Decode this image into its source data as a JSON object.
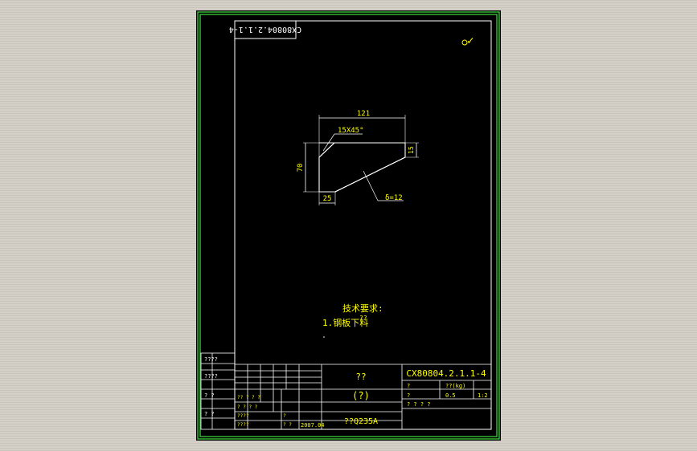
{
  "drawing": {
    "rotated_number": "CX80804.2.1.1-4",
    "surface_mark": "✓",
    "dims": {
      "width_top": "121",
      "chamfer": "15X45°",
      "height": "70",
      "side_right": "15",
      "bottom": "25",
      "thickness": "δ=12"
    },
    "notes": {
      "heading": "技术要求:",
      "note1": "1.钢板下料",
      "overlap": "??"
    }
  },
  "title_block": {
    "left_cells": [
      "????",
      "????",
      "?  ?",
      "?  ?"
    ],
    "name_line1": "??",
    "name_line2": "(?)",
    "drawing_number": "CX80804.2.1.1-4",
    "material": "??Q235A",
    "date": "2007.04",
    "weight_header": "??(kg)",
    "weight": "0.5",
    "scale": "1:2",
    "q": "?",
    "sheet_info": "?  ?  ?  ?",
    "row_a": "??  ?  ?  ?",
    "row_b": "?  ?  ?  ?",
    "row_c": "????",
    "row_d": "????",
    "row_e": "?",
    "row_f": "?  ?"
  }
}
